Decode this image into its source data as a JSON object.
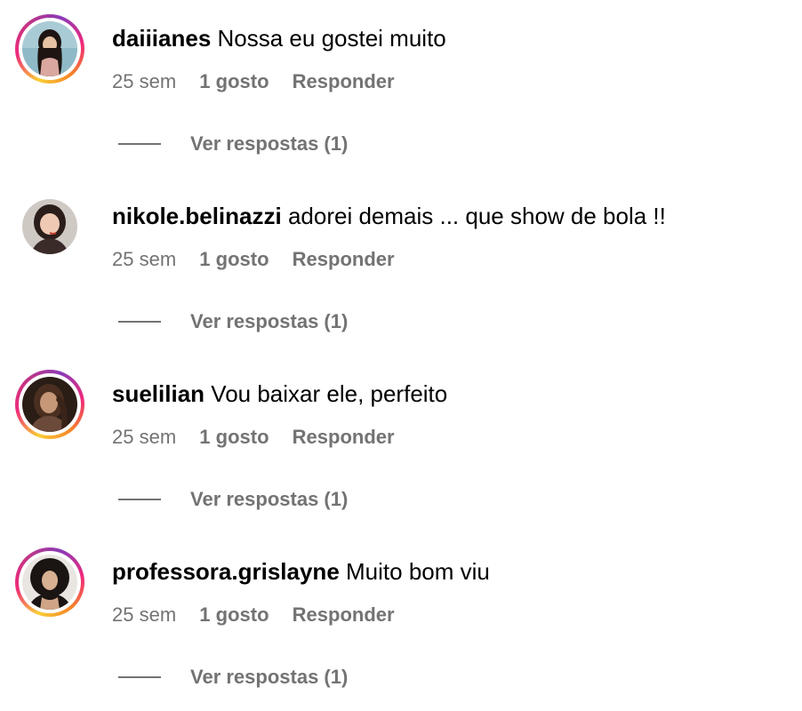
{
  "comments": [
    {
      "username": "daiiianes",
      "text": "Nossa eu gostei muito",
      "age": "25 sem",
      "likes": "1 gosto",
      "reply_label": "Responder",
      "view_replies": "Ver respostas (1)",
      "story_ring": true
    },
    {
      "username": "nikole.belinazzi",
      "text": "adorei demais ... que show de bola !!",
      "age": "25 sem",
      "likes": "1 gosto",
      "reply_label": "Responder",
      "view_replies": "Ver respostas (1)",
      "story_ring": false
    },
    {
      "username": "suelilian",
      "text": "Vou baixar ele, perfeito",
      "age": "25 sem",
      "likes": "1 gosto",
      "reply_label": "Responder",
      "view_replies": "Ver respostas (1)",
      "story_ring": true
    },
    {
      "username": "professora.grislayne",
      "text": "Muito bom viu",
      "age": "25 sem",
      "likes": "1 gosto",
      "reply_label": "Responder",
      "view_replies": "Ver respostas (1)",
      "story_ring": true
    }
  ],
  "colors": {
    "text_primary": "#000000",
    "text_secondary": "#737373",
    "story_ring_gradient": [
      "#f9ce34",
      "#ee2a7b",
      "#8a3ab9"
    ]
  }
}
